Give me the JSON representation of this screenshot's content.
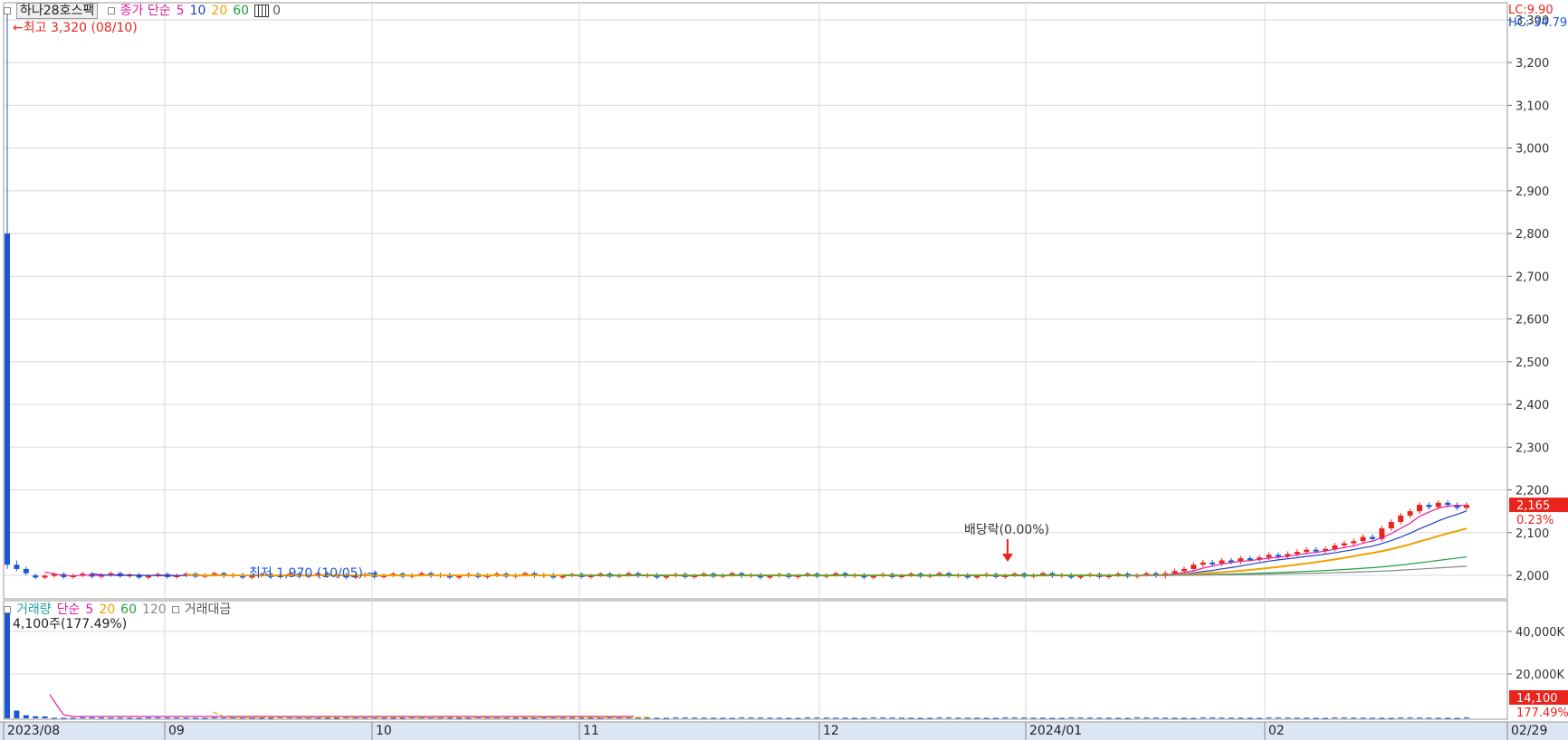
{
  "chart_data": {
    "type": "candlestick",
    "stock_name": "하나28호스팩",
    "price_legend": {
      "label": "종가 단순",
      "periods": [
        "5",
        "10",
        "20",
        "60"
      ],
      "extra": "0"
    },
    "colors": {
      "up": "#e8241c",
      "down": "#1a57d4",
      "ma5": "#e020a0",
      "ma10": "#2040c0",
      "ma20": "#f0a000",
      "ma60": "#20a040",
      "ma120": "#888888",
      "grid": "#d8d8d8",
      "bottom_bar": "#dce6f2"
    },
    "x_labels": [
      "2023/08",
      "09",
      "10",
      "11",
      "12",
      "2024/01",
      "02",
      "02/29"
    ],
    "y_ticks": [
      "3,300",
      "3,200",
      "3,100",
      "3,000",
      "2,900",
      "2,800",
      "2,700",
      "2,600",
      "2,500",
      "2,400",
      "2,300",
      "2,200",
      "2,100",
      "2,000"
    ],
    "y_range": [
      1945,
      3340
    ],
    "top_right": {
      "lc": "LC:9.90",
      "hc": "HC:-34.79"
    },
    "current_price": {
      "value": "2,165",
      "change": "0.23%"
    },
    "annotations": {
      "high": "최고 3,320 (08/10)",
      "low": "최저 1,970 (10/05)",
      "dividend": "배당락(0.00%)"
    },
    "candles": [
      {
        "o": 2800,
        "h": 3320,
        "l": 2015,
        "c": 2025
      },
      {
        "o": 2025,
        "h": 2035,
        "l": 2010,
        "c": 2015
      },
      {
        "o": 2015,
        "h": 2020,
        "l": 2000,
        "c": 2005
      }
    ],
    "steady_close": 2000,
    "rally_closes": [
      2005,
      2010,
      2015,
      2025,
      2030,
      2028,
      2035,
      2032,
      2040,
      2038,
      2042,
      2048,
      2045,
      2050,
      2055,
      2060,
      2058,
      2062,
      2070,
      2075,
      2080,
      2090,
      2085,
      2110,
      2125,
      2140,
      2150,
      2165,
      2160,
      2170,
      2165,
      2158,
      2165
    ],
    "volume": {
      "legend_label": "거래량",
      "ma_label": "단순",
      "periods": [
        "5",
        "20",
        "60",
        "120"
      ],
      "extra_label": "거래대금",
      "info": "4,100주(177.49%)",
      "y_ticks": [
        "40,000K",
        "20,000K"
      ],
      "current": {
        "value": "14,100",
        "change": "177.49%"
      }
    }
  }
}
